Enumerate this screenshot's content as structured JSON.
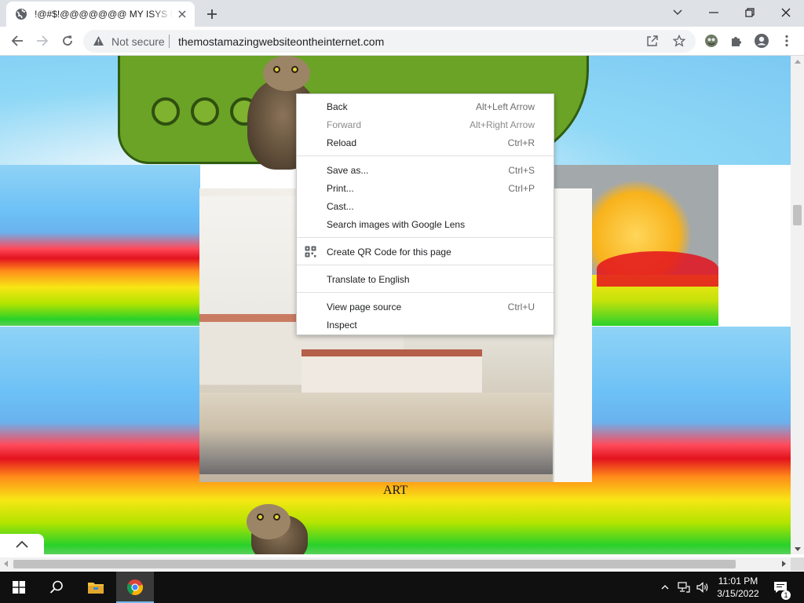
{
  "browser": {
    "tab": {
      "title": "!@#$!@@@@@@@ MY ISYS PROJECT",
      "favicon": "globe-icon"
    },
    "omnibox": {
      "security_label": "Not secure",
      "url": "themostamazingwebsiteontheinternet.com"
    }
  },
  "page": {
    "caption": "ART"
  },
  "context_menu": {
    "groups": [
      [
        {
          "label": "Back",
          "shortcut": "Alt+Left Arrow",
          "enabled": true
        },
        {
          "label": "Forward",
          "shortcut": "Alt+Right Arrow",
          "enabled": false
        },
        {
          "label": "Reload",
          "shortcut": "Ctrl+R",
          "enabled": true
        }
      ],
      [
        {
          "label": "Save as...",
          "shortcut": "Ctrl+S",
          "enabled": true
        },
        {
          "label": "Print...",
          "shortcut": "Ctrl+P",
          "enabled": true
        },
        {
          "label": "Cast...",
          "shortcut": "",
          "enabled": true
        },
        {
          "label": "Search images with Google Lens",
          "shortcut": "",
          "enabled": true
        }
      ],
      [
        {
          "label": "Create QR Code for this page",
          "shortcut": "",
          "enabled": true,
          "icon": "qr-code-icon"
        }
      ],
      [
        {
          "label": "Translate to English",
          "shortcut": "",
          "enabled": true
        }
      ],
      [
        {
          "label": "View page source",
          "shortcut": "Ctrl+U",
          "enabled": true
        },
        {
          "label": "Inspect",
          "shortcut": "",
          "enabled": true
        }
      ]
    ]
  },
  "taskbar": {
    "time": "11:01 PM",
    "date": "3/15/2022",
    "notification_count": "1"
  },
  "colors": {
    "tabstrip": "#dee1e6",
    "omnibox": "#f1f3f4",
    "taskbar": "#101010",
    "accent": "#76b9ed"
  }
}
